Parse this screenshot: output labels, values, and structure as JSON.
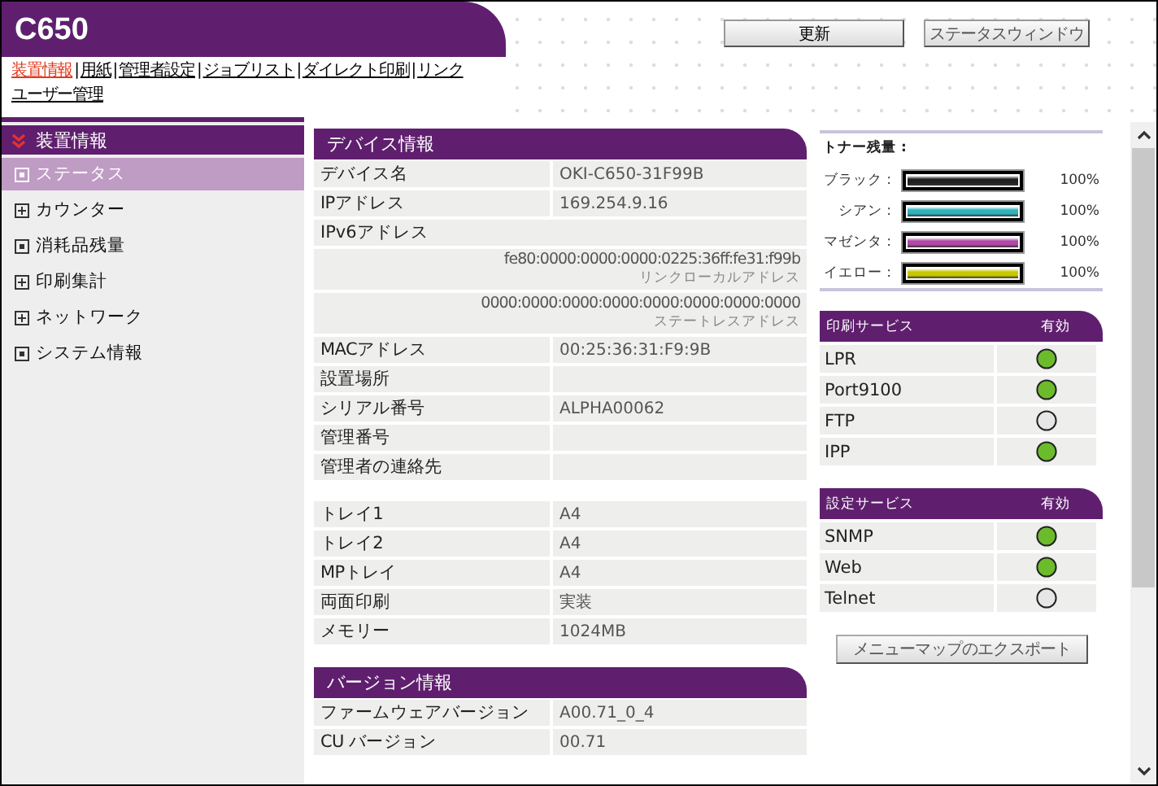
{
  "header": {
    "title": "C650",
    "buttons": [
      "更新",
      "ステータスウィンドウ"
    ]
  },
  "nav_separator": "|",
  "nav": [
    {
      "label": "装置情報",
      "selected": true
    },
    {
      "label": "用紙",
      "selected": false
    },
    {
      "label": "管理者設定",
      "selected": false
    },
    {
      "label": "ジョブリスト",
      "selected": false
    },
    {
      "label": "ダイレクト印刷",
      "selected": false
    },
    {
      "label": "リンク",
      "selected": false
    },
    {
      "label": "ユーザー管理",
      "selected": false
    }
  ],
  "sidebar": {
    "title": "装置情報",
    "items": [
      {
        "label": "ステータス",
        "kind": "leaf",
        "selected": true
      },
      {
        "label": "カウンター",
        "kind": "expandable",
        "selected": false
      },
      {
        "label": "消耗品残量",
        "kind": "leaf",
        "selected": false
      },
      {
        "label": "印刷集計",
        "kind": "expandable",
        "selected": false
      },
      {
        "label": "ネットワーク",
        "kind": "expandable",
        "selected": false
      },
      {
        "label": "システム情報",
        "kind": "leaf",
        "selected": false
      }
    ]
  },
  "device_info": {
    "title": "デバイス情報",
    "groups": [
      [
        {
          "kind": "pair",
          "label": "デバイス名",
          "value": "OKI-C650-31F99B"
        },
        {
          "kind": "pair",
          "label": "IPアドレス",
          "value": "169.254.9.16"
        },
        {
          "kind": "heading",
          "label": "IPv6アドレス"
        },
        {
          "kind": "address",
          "value": "fe80:0000:0000:0000:0225:36ff:fe31:f99b",
          "caption": "リンクローカルアドレス"
        },
        {
          "kind": "address",
          "value": "0000:0000:0000:0000:0000:0000:0000:0000",
          "caption": "ステートレスアドレス"
        },
        {
          "kind": "pair",
          "label": "MACアドレス",
          "value": "00:25:36:31:F9:9B"
        },
        {
          "kind": "pair",
          "label": "設置場所"
        },
        {
          "kind": "pair",
          "label": "シリアル番号",
          "value": "ALPHA00062"
        },
        {
          "kind": "pair",
          "label": "管理番号"
        },
        {
          "kind": "pair",
          "label": "管理者の連絡先"
        }
      ],
      [
        {
          "kind": "pair",
          "label": "トレイ1",
          "value": "A4"
        },
        {
          "kind": "pair",
          "label": "トレイ2",
          "value": "A4"
        },
        {
          "kind": "pair",
          "label": "MPトレイ",
          "value": "A4"
        },
        {
          "kind": "pair",
          "label": "両面印刷",
          "value": "実装"
        },
        {
          "kind": "pair",
          "label": "メモリー",
          "value": "1024MB"
        }
      ]
    ]
  },
  "version_info": {
    "title": "バージョン情報",
    "rows": [
      {
        "label": "ファームウェアバージョン",
        "value": "A00.71_0_4"
      },
      {
        "label": "CU バージョン",
        "value": "00.71"
      }
    ]
  },
  "toner": {
    "title": "トナー残量 :",
    "items": [
      {
        "name": "ブラック :",
        "level": 1,
        "reading": "100%",
        "color": "#202020"
      },
      {
        "name": "シアン :",
        "level": 1,
        "reading": "100%",
        "color": "#2fb3bd"
      },
      {
        "name": "マゼンタ :",
        "level": 1,
        "reading": "100%",
        "color": "#b048a8"
      },
      {
        "name": "イエロー :",
        "level": 1,
        "reading": "100%",
        "color": "#c8c800"
      }
    ]
  },
  "print_services": {
    "title": "印刷サービス",
    "column": "有効",
    "rows": [
      {
        "name": "LPR",
        "enabled": true
      },
      {
        "name": "Port9100",
        "enabled": true
      },
      {
        "name": "FTP",
        "enabled": false
      },
      {
        "name": "IPP",
        "enabled": true
      }
    ]
  },
  "config_services": {
    "title": "設定サービス",
    "column": "有効",
    "rows": [
      {
        "name": "SNMP",
        "enabled": true
      },
      {
        "name": "Web",
        "enabled": true
      },
      {
        "name": "Telnet",
        "enabled": false
      }
    ]
  },
  "export_button": "メニューマップのエクスポート"
}
